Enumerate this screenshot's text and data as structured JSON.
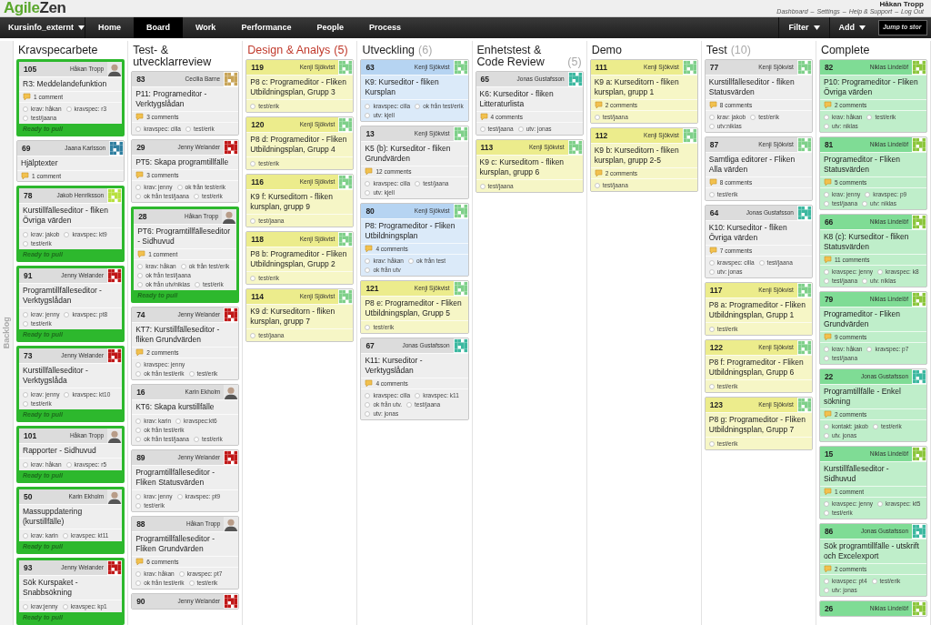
{
  "logo": {
    "part_1": "Agile",
    "part_2": "Zen"
  },
  "user": {
    "name": "Håkan Tropp",
    "links": [
      "Dashboard",
      "Settings",
      "Help & Support",
      "Log Out"
    ],
    "separator": "–"
  },
  "nav": {
    "project": "Kursinfo_externt",
    "items": [
      {
        "label": "Home",
        "selected": false
      },
      {
        "label": "Board",
        "selected": true
      },
      {
        "label": "Work",
        "selected": false
      },
      {
        "label": "Performance",
        "selected": false
      },
      {
        "label": "People",
        "selected": false
      },
      {
        "label": "Process",
        "selected": false
      }
    ],
    "menus": [
      "Filter",
      "Add"
    ],
    "search": {
      "placeholder": "Jump to stor"
    }
  },
  "backlog": {
    "label": "Backlog"
  },
  "columns": [
    {
      "title": "Kravspecarbete",
      "over_limit": false,
      "cards": [
        {
          "number": "105",
          "person": "Håkan Tropp",
          "avatar": {
            "kind": "photo"
          },
          "color": "#dcdcdc",
          "title": "R3: Meddelandefunktion",
          "comments": "1 comment",
          "tags": [
            "krav: håkan",
            "kravspec: r3",
            "test/jaana"
          ],
          "footer": "Ready to pull"
        },
        {
          "number": "69",
          "person": "Jaana Karlsson",
          "avatar": {
            "kind": "pattern",
            "color": "#2f7fa0"
          },
          "color": "#dcdcdc",
          "title": "Hjälptexter",
          "comments": "1 comment"
        },
        {
          "number": "78",
          "person": "Jakob Henriksson",
          "avatar": {
            "kind": "pattern",
            "color": "#b8e040"
          },
          "color": "#dcdcdc",
          "title": "Kurstillfälleseditor - fliken Övriga värden",
          "tags": [
            "krav: jakob",
            "kravspec: kt9",
            "test/erik"
          ],
          "footer": "Ready to pull"
        },
        {
          "number": "91",
          "person": "Jenny Welander",
          "avatar": {
            "kind": "pattern",
            "color": "#c01818"
          },
          "color": "#dcdcdc",
          "title": "Programtillfälleseditor - Verktygslådan",
          "tags": [
            "krav: jenny",
            "kravspec: pt8",
            "test/erik"
          ],
          "footer": "Ready to pull"
        },
        {
          "number": "73",
          "person": "Jenny Welander",
          "avatar": {
            "kind": "pattern",
            "color": "#c01818"
          },
          "color": "#dcdcdc",
          "title": "Kurstillfälleseditor - Verktygslåda",
          "tags": [
            "krav: jenny",
            "kravspec: kt10",
            "test/erik"
          ],
          "footer": "Ready to pull"
        },
        {
          "number": "101",
          "person": "Håkan Tropp",
          "avatar": {
            "kind": "photo"
          },
          "color": "#dcdcdc",
          "title": "Rapporter - Sidhuvud",
          "tags": [
            "krav: håkan",
            "kravspec: r5"
          ],
          "footer": "Ready to pull"
        },
        {
          "number": "50",
          "person": "Karin Ekholm",
          "avatar": {
            "kind": "photo"
          },
          "color": "#dcdcdc",
          "title": "Massuppdatering (kurstillfälle)",
          "tags": [
            "krav: karin",
            "kravspec: kt11"
          ],
          "footer": "Ready to pull"
        },
        {
          "number": "93",
          "person": "Jenny Welander",
          "avatar": {
            "kind": "pattern",
            "color": "#c01818"
          },
          "color": "#dcdcdc",
          "title": "Sök Kurspaket - Snabbsökning",
          "tags": [
            "krav:jenny",
            "kravspec: kp1"
          ],
          "footer": "Ready to pull"
        }
      ]
    },
    {
      "title": "Test- & utvecklarreview",
      "over_limit": false,
      "cards": [
        {
          "number": "83",
          "person": "Cecilia Barne",
          "avatar": {
            "kind": "pattern",
            "color": "#c8a458"
          },
          "color": "#dcdcdc",
          "title": "P11: Programeditor - Verktygslådan",
          "comments": "3 comments",
          "tags": [
            "kravspec: cilla",
            "test/erik"
          ]
        },
        {
          "number": "29",
          "person": "Jenny Welander",
          "avatar": {
            "kind": "pattern",
            "color": "#c01818"
          },
          "color": "#dcdcdc",
          "title": "PT5: Skapa programtillfälle",
          "comments": "3 comments",
          "tags": [
            "krav: jenny",
            "ok från test/erik",
            "ok från test/jaana",
            "test/erik"
          ]
        },
        {
          "number": "28",
          "person": "Håkan Tropp",
          "avatar": {
            "kind": "photo"
          },
          "color": "#dcdcdc",
          "title": "PT6: Programtillfälleseditor - Sidhuvud",
          "comments": "1 comment",
          "tags": [
            "krav: håkan",
            "ok från test/erik",
            "ok från test/jaana",
            "ok från utv/niklas",
            "test/erik"
          ],
          "footer": "Ready to pull"
        },
        {
          "number": "74",
          "person": "Jenny Welander",
          "avatar": {
            "kind": "pattern",
            "color": "#c01818"
          },
          "color": "#dcdcdc",
          "title": "KT7: Kurstillfälleseditor - fliken Grundvärden",
          "comments": "2 comments",
          "tags": [
            "kravspec: jenny",
            "ok från test/erik",
            "test/erik"
          ]
        },
        {
          "number": "16",
          "person": "Karin Ekholm",
          "avatar": {
            "kind": "photo"
          },
          "color": "#dcdcdc",
          "title": "KT6: Skapa kurstillfälle",
          "tags": [
            "krav: karin",
            "kravspec:kt6",
            "ok från test/erik",
            "ok från test/jaana",
            "test/erik"
          ]
        },
        {
          "number": "89",
          "person": "Jenny Welander",
          "avatar": {
            "kind": "pattern",
            "color": "#c01818"
          },
          "color": "#dcdcdc",
          "title": "Programtillfälleseditor - Fliken Statusvärden",
          "tags": [
            "krav: jenny",
            "kravspec: pt9",
            "test/erik"
          ]
        },
        {
          "number": "88",
          "person": "Håkan Tropp",
          "avatar": {
            "kind": "photo"
          },
          "color": "#dcdcdc",
          "title": "Programtillfälleseditor - Fliken Grundvärden",
          "comments": "6 comments",
          "tags": [
            "krav: håkan",
            "kravspec: pt7",
            "ok från test/erik",
            "test/erik"
          ]
        },
        {
          "number": "90",
          "person": "Jenny Welander",
          "avatar": {
            "kind": "pattern",
            "color": "#c01818"
          },
          "color": "#dcdcdc"
        }
      ]
    },
    {
      "title": "Design & Analys",
      "count": "(5)",
      "over_limit": true,
      "cards": [
        {
          "number": "119",
          "person": "Kenji Sjökvist",
          "avatar": {
            "kind": "pattern",
            "color": "#7fd08a"
          },
          "color": "#ecec8c",
          "title": "P8 c: Programeditor - Fliken Utbildningsplan, Grupp 3",
          "tags": [
            "test/erik"
          ]
        },
        {
          "number": "120",
          "person": "Kenji Sjökvist",
          "avatar": {
            "kind": "pattern",
            "color": "#7fd08a"
          },
          "color": "#ecec8c",
          "title": "P8 d: Programeditor - Fliken Utbildningsplan, Grupp 4",
          "tags": [
            "test/erik"
          ]
        },
        {
          "number": "116",
          "person": "Kenji Sjökvist",
          "avatar": {
            "kind": "pattern",
            "color": "#7fd08a"
          },
          "color": "#ecec8c",
          "title": "K9 f: Kurseditorn - fliken kursplan, grupp 9",
          "tags": [
            "test/jaana"
          ]
        },
        {
          "number": "118",
          "person": "Kenji Sjökvist",
          "avatar": {
            "kind": "pattern",
            "color": "#7fd08a"
          },
          "color": "#ecec8c",
          "title": "P8 b: Programeditor - Fliken Utbildningsplan, Grupp 2",
          "tags": [
            "test/erik"
          ]
        },
        {
          "number": "114",
          "person": "Kenji Sjökvist",
          "avatar": {
            "kind": "pattern",
            "color": "#7fd08a"
          },
          "color": "#ecec8c",
          "title": "K9 d: Kurseditorn - fliken kursplan, grupp 7",
          "tags": [
            "test/jaana"
          ]
        }
      ]
    },
    {
      "title": "Utveckling",
      "count": "(6)",
      "over_limit": false,
      "cards": [
        {
          "number": "63",
          "person": "Kenji Sjökvist",
          "avatar": {
            "kind": "pattern",
            "color": "#7fd08a"
          },
          "color": "#b6d4f2",
          "title": "K9: Kurseditor - fliken Kursplan",
          "tags": [
            "kravspec: cilla",
            "ok från test/erik",
            "utv: kjell"
          ]
        },
        {
          "number": "13",
          "person": "Kenji Sjökvist",
          "avatar": {
            "kind": "pattern",
            "color": "#7fd08a"
          },
          "color": "#dcdcdc",
          "title": "K5 (b): Kurseditor - fliken Grundvärden",
          "comments": "12 comments",
          "tags": [
            "kravspec: cilla",
            "test/jaana",
            "utv: kjell"
          ]
        },
        {
          "number": "80",
          "person": "Kenji Sjökvist",
          "avatar": {
            "kind": "pattern",
            "color": "#7fd08a"
          },
          "color": "#b6d4f2",
          "title": "P8: Programeditor - Fliken Utbildningsplan",
          "comments": "4 comments",
          "tags": [
            "krav: håkan",
            "ok från test",
            "ok från utv"
          ]
        },
        {
          "number": "121",
          "person": "Kenji Sjökvist",
          "avatar": {
            "kind": "pattern",
            "color": "#7fd08a"
          },
          "color": "#ecec8c",
          "title": "P8 e: Programeditor - Fliken Utbildningsplan, Grupp 5",
          "tags": [
            "test/erik"
          ]
        },
        {
          "number": "67",
          "person": "Jonas Gustafsson",
          "avatar": {
            "kind": "pattern",
            "color": "#3cb8a0"
          },
          "color": "#dcdcdc",
          "title": "K11: Kurseditor - Verktygslådan",
          "comments": "4 comments",
          "tags": [
            "kravspec: cilla",
            "kravspec: k11",
            "ok från utv.",
            "test/jaana",
            "utv: jonas"
          ]
        }
      ]
    },
    {
      "title": "Enhetstest & Code Review",
      "count": "(5)",
      "over_limit": false,
      "cards": [
        {
          "number": "65",
          "person": "Jonas Gustafsson",
          "avatar": {
            "kind": "pattern",
            "color": "#3cb8a0"
          },
          "color": "#dcdcdc",
          "title": "K6: Kurseditor - fliken Litteraturlista",
          "comments": "4 comments",
          "tags": [
            "test/jaana",
            "utv: jonas"
          ]
        },
        {
          "number": "113",
          "person": "Kenji Sjökvist",
          "avatar": {
            "kind": "pattern",
            "color": "#7fd08a"
          },
          "color": "#ecec8c",
          "title": "K9 c: Kurseditorn - fliken kursplan, grupp 6",
          "tags": [
            "test/jaana"
          ]
        }
      ]
    },
    {
      "title": "Demo",
      "over_limit": false,
      "cards": [
        {
          "number": "111",
          "person": "Kenji Sjökvist",
          "avatar": {
            "kind": "pattern",
            "color": "#7fd08a"
          },
          "color": "#ecec8c",
          "title": "K9 a: Kurseditorn - fliken kursplan, grupp 1",
          "comments": "2 comments",
          "tags": [
            "test/jaana"
          ]
        },
        {
          "number": "112",
          "person": "Kenji Sjökvist",
          "avatar": {
            "kind": "pattern",
            "color": "#7fd08a"
          },
          "color": "#ecec8c",
          "title": "K9 b: Kurseditorn - fliken kursplan, grupp 2-5",
          "comments": "2 comments",
          "tags": [
            "test/jaana"
          ]
        }
      ]
    },
    {
      "title": "Test",
      "count": "(10)",
      "over_limit": false,
      "cards": [
        {
          "number": "77",
          "person": "Kenji Sjökvist",
          "avatar": {
            "kind": "pattern",
            "color": "#7fd08a"
          },
          "color": "#dcdcdc",
          "title": "Kurstillfälleseditor - fliken Statusvärden",
          "comments": "8 comments",
          "tags": [
            "krav: jakob",
            "test/erik",
            "utv:niklas"
          ]
        },
        {
          "number": "87",
          "person": "Kenji Sjökvist",
          "avatar": {
            "kind": "pattern",
            "color": "#7fd08a"
          },
          "color": "#dcdcdc",
          "title": "Samtliga editorer - Fliken Alla värden",
          "comments": "8 comments",
          "tags": [
            "test/erik"
          ]
        },
        {
          "number": "64",
          "person": "Jonas Gustafsson",
          "avatar": {
            "kind": "pattern",
            "color": "#3cb8a0"
          },
          "color": "#dcdcdc",
          "title": "K10: Kurseditor - fliken Övriga värden",
          "comments": "7 comments",
          "tags": [
            "kravspec: cilla",
            "test/jaana",
            "utv: jonas"
          ]
        },
        {
          "number": "117",
          "person": "Kenji Sjökvist",
          "avatar": {
            "kind": "pattern",
            "color": "#7fd08a"
          },
          "color": "#ecec8c",
          "title": "P8 a: Programeditor - Fliken Utbildningsplan, Grupp 1",
          "tags": [
            "test/erik"
          ]
        },
        {
          "number": "122",
          "person": "Kenji Sjökvist",
          "avatar": {
            "kind": "pattern",
            "color": "#7fd08a"
          },
          "color": "#ecec8c",
          "title": "P8 f: Programeditor - Fliken Utbildningsplan, Grupp 6",
          "tags": [
            "test/erik"
          ]
        },
        {
          "number": "123",
          "person": "Kenji Sjökvist",
          "avatar": {
            "kind": "pattern",
            "color": "#7fd08a"
          },
          "color": "#ecec8c",
          "title": "P8 g: Programeditor - Fliken Utbildningsplan, Grupp 7",
          "tags": [
            "test/erik"
          ]
        }
      ]
    },
    {
      "title": "Complete",
      "over_limit": false,
      "cards": [
        {
          "number": "82",
          "person": "Niklas Lindelöf",
          "avatar": {
            "kind": "pattern",
            "color": "#8cc63c"
          },
          "color": "#7fdc95",
          "title": "P10: Programeditor - Fliken Övriga värden",
          "comments": "2 comments",
          "tags": [
            "krav: håkan",
            "test/erik",
            "utv: niklas"
          ]
        },
        {
          "number": "81",
          "person": "Niklas Lindelöf",
          "avatar": {
            "kind": "pattern",
            "color": "#8cc63c"
          },
          "color": "#7fdc95",
          "title": "Programeditor - Fliken Statusvärden",
          "comments": "5 comments",
          "tags": [
            "krav: jenny",
            "kravspec: p9",
            "test/jaana",
            "utv: niklas"
          ]
        },
        {
          "number": "66",
          "person": "Niklas Lindelöf",
          "avatar": {
            "kind": "pattern",
            "color": "#8cc63c"
          },
          "color": "#7fdc95",
          "title": "K8 (c): Kurseditor - fliken Statusvärden",
          "comments": "11 comments",
          "tags": [
            "kravspec: jenny",
            "kravspec: k8",
            "test/jaana",
            "utv. niklas"
          ]
        },
        {
          "number": "79",
          "person": "Niklas Lindelöf",
          "avatar": {
            "kind": "pattern",
            "color": "#8cc63c"
          },
          "color": "#7fdc95",
          "title": "Programeditor - Fliken Grundvärden",
          "comments": "9 comments",
          "tags": [
            "krav: håkan",
            "kravspec: p7",
            "test/jaana"
          ]
        },
        {
          "number": "22",
          "person": "Jonas Gustafsson",
          "avatar": {
            "kind": "pattern",
            "color": "#3cb8a0"
          },
          "color": "#7fdc95",
          "title": "Programtillfälle - Enkel sökning",
          "comments": "2 comments",
          "tags": [
            "kontakt: jakob",
            "test/erik",
            "utv. jonas"
          ]
        },
        {
          "number": "15",
          "person": "Niklas Lindelöf",
          "avatar": {
            "kind": "pattern",
            "color": "#8cc63c"
          },
          "color": "#7fdc95",
          "title": "Kurstillfälleseditor - Sidhuvud",
          "comments": "1 comment",
          "tags": [
            "kravspec: jenny",
            "kravspec: kt5",
            "test/erik"
          ]
        },
        {
          "number": "86",
          "person": "Jonas Gustafsson",
          "avatar": {
            "kind": "pattern",
            "color": "#3cb8a0"
          },
          "color": "#7fdc95",
          "title": "Sök programtillfälle - utskrift och Excelexport",
          "comments": "2 comments",
          "tags": [
            "kravspec: pt4",
            "test/erik",
            "utv: jonas"
          ]
        },
        {
          "number": "26",
          "person": "Niklas Lindelöf",
          "avatar": {
            "kind": "pattern",
            "color": "#8cc63c"
          },
          "color": "#7fdc95"
        }
      ]
    }
  ]
}
